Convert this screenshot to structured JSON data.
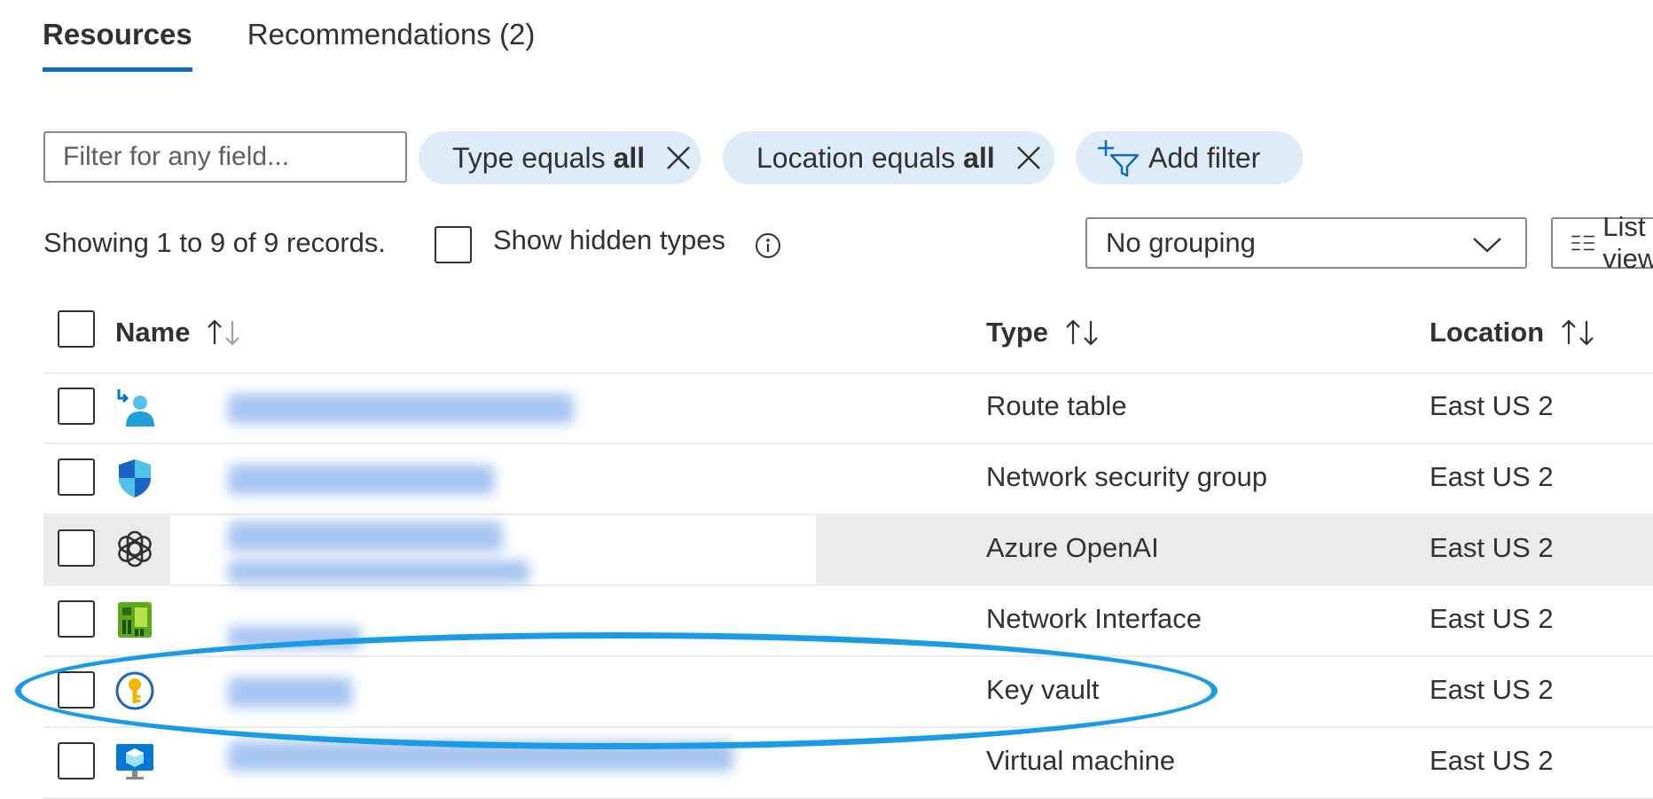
{
  "tabs": [
    {
      "label": "Resources"
    },
    {
      "label": "Recommendations (2)"
    }
  ],
  "filter": {
    "placeholder": "Filter for any field..."
  },
  "pills": [
    {
      "prefix": "Type equals",
      "value": "all"
    },
    {
      "prefix": "Location equals",
      "value": "all"
    }
  ],
  "add_filter": {
    "label": "Add filter"
  },
  "records_text": "Showing 1 to 9 of 9 records.",
  "show_hidden": {
    "label": "Show hidden types"
  },
  "grouping": {
    "selected": "No grouping"
  },
  "view": {
    "label": "List view"
  },
  "columns": {
    "name": "Name",
    "type": "Type",
    "location": "Location"
  },
  "rows": [
    {
      "icon": "route-table-icon",
      "type": "Route table",
      "location": "East US 2"
    },
    {
      "icon": "network-security-group-icon",
      "type": "Network security group",
      "location": "East US 2"
    },
    {
      "icon": "azure-openai-icon",
      "type": "Azure OpenAI",
      "location": "East US 2"
    },
    {
      "icon": "network-interface-icon",
      "type": "Network Interface",
      "location": "East US 2"
    },
    {
      "icon": "key-vault-icon",
      "type": "Key vault",
      "location": "East US 2"
    },
    {
      "icon": "virtual-machine-icon",
      "type": "Virtual machine",
      "location": "East US 2"
    }
  ],
  "colors": {
    "accent": "#0f6cbd",
    "pill_bg": "#deecf9",
    "highlight_row": "#edebe9",
    "annotation": "#1a9be8"
  }
}
